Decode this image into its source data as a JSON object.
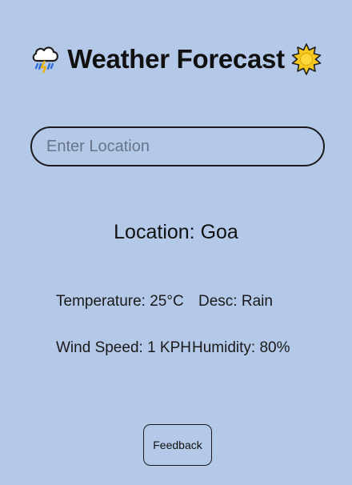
{
  "header": {
    "title": "Weather Forecast",
    "left_icon": "storm-cloud-icon",
    "right_icon": "sun-icon"
  },
  "search": {
    "placeholder": "Enter Location",
    "value": ""
  },
  "weather": {
    "location": "Location: Goa",
    "temperature": "Temperature: 25°C",
    "description": "Desc: Rain",
    "wind_speed": "Wind Speed: 1 KPH",
    "humidity": "Humidity: 80%"
  },
  "actions": {
    "feedback_label": "Feedback"
  },
  "colors": {
    "background": "#b4c8e8",
    "border": "#1b1b1b",
    "sun": "#f7c820"
  }
}
